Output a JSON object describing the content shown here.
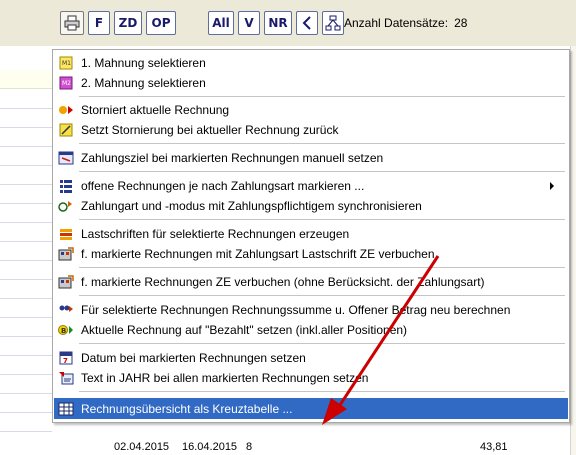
{
  "toolbar": {
    "buttons": [
      {
        "name": "print-button",
        "label": ""
      },
      {
        "name": "filter-button",
        "label": "F"
      },
      {
        "name": "zd-button",
        "label": "ZD"
      },
      {
        "name": "op-button",
        "label": "OP"
      },
      {
        "name": "all-button",
        "label": "All"
      },
      {
        "name": "v-button",
        "label": "V"
      },
      {
        "name": "nr-button",
        "label": "NR"
      },
      {
        "name": "sigma-button",
        "label": ""
      },
      {
        "name": "network-button",
        "label": ""
      }
    ],
    "record_count_label": "Anzahl Datensätze:",
    "record_count_value": "28"
  },
  "menu": {
    "items": [
      {
        "label": "1. Mahnung selektieren",
        "icon": "mahnung-1-icon"
      },
      {
        "label": "2. Mahnung selektieren",
        "icon": "mahnung-2-icon"
      },
      {
        "label": "Storniert aktuelle Rechnung",
        "icon": "storno-icon"
      },
      {
        "label": "Setzt Stornierung bei aktueller Rechnung zurück",
        "icon": "storno-reset-icon"
      },
      {
        "label": "Zahlungsziel bei markierten Rechnungen manuell setzen",
        "icon": "calendar-icon"
      },
      {
        "label": "offene Rechnungen je nach Zahlungsart markieren ...",
        "icon": "list-icon",
        "submenu": true
      },
      {
        "label": "Zahlungart und -modus mit Zahlungspflichtigem synchronisieren",
        "icon": "sync-icon"
      },
      {
        "label": "Lastschriften für selektierte Rechnungen erzeugen",
        "icon": "lastschrift-icon"
      },
      {
        "label": "f. markierte Rechnungen mit Zahlungsart Lastschrift ZE verbuchen",
        "icon": "book-icon"
      },
      {
        "label": "f. markierte Rechnungen ZE verbuchen (ohne Berücksicht. der Zahlungsart)",
        "icon": "book-icon"
      },
      {
        "label": "Für selektierte Rechnungen Rechnungssumme u. Offener Betrag neu berechnen",
        "icon": "recalc-icon"
      },
      {
        "label": "Aktuelle Rechnung auf \"Bezahlt\" setzen (inkl.aller Positionen)",
        "icon": "paid-icon"
      },
      {
        "label": "Datum bei markierten Rechnungen setzen",
        "icon": "date-icon"
      },
      {
        "label": "Text in JAHR bei allen markierten Rechnungen setzen",
        "icon": "text-icon"
      },
      {
        "label": "Rechnungsübersicht als Kreuztabelle ...",
        "icon": "table-icon"
      }
    ]
  },
  "bottom_row": {
    "date1": "02.04.2015",
    "date2": "16.04.2015",
    "num": "8",
    "amount": "43,81"
  },
  "colors": {
    "highlight": "#316ac5",
    "annotation_arrow": "#cc0000"
  }
}
